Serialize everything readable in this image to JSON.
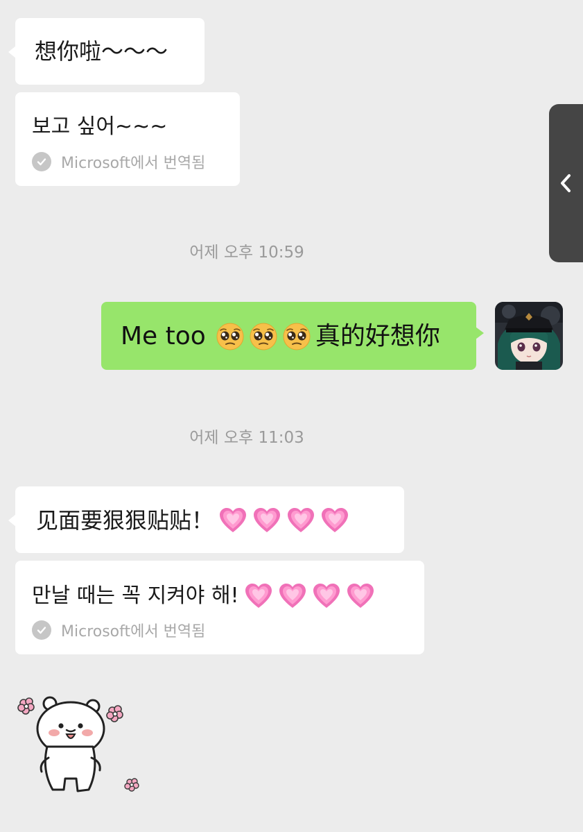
{
  "messages": {
    "m1_text": "想你啦～～～",
    "m1_translation": "보고 싶어~~~",
    "translation_label": "Microsoft에서 번역됨",
    "timestamp1": "어제 오후 10:59",
    "m2_text_prefix": "Me too",
    "m2_text_suffix": "真的好想你",
    "timestamp2": "어제 오후 11:03",
    "m3_text": "见面要狠狠贴贴！",
    "m3_translation": "만날 때는 꼭 지켜야 해!",
    "m3_translation_label": "Microsoft에서 번역됨"
  },
  "icons": {
    "side_tab": "chevron-left-icon",
    "translate_check": "check-circle-icon",
    "emoji": "pleading-face-emoji",
    "heart": "growing-heart-emoji",
    "sticker": "bear-sticker"
  },
  "colors": {
    "background": "#ececec",
    "incoming_bubble": "#ffffff",
    "outgoing_bubble": "#97e56b",
    "side_tab": "#454545",
    "muted_text": "#9a9a9a"
  }
}
